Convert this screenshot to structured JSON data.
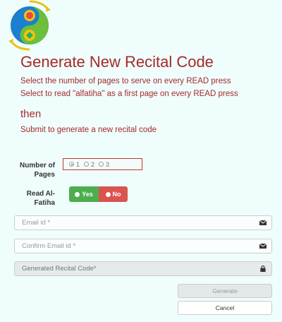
{
  "header": {
    "title": "Generate New Recital Code",
    "instruction_1": "Select the number of pages to serve on every READ press",
    "instruction_2": "Select to read \"alfatiha\" as a first page on every READ press",
    "then": "then",
    "instruction_3": "Submit to generate a new recital code"
  },
  "form": {
    "pages_label": "Number of Pages",
    "pages_options": [
      "1",
      "2",
      "3"
    ],
    "pages_selected": "1",
    "fatiha_label": "Read Al-Fatiha",
    "fatiha_yes": "Yes",
    "fatiha_no": "No",
    "email_placeholder": "Email id *",
    "confirm_email_placeholder": "Confirm Email id *",
    "code_placeholder": "Generated Recital Code*"
  },
  "actions": {
    "generate_label": "Generate",
    "cancel_label": "Cancel"
  },
  "colors": {
    "title": "#a52a2a",
    "yes": "#4cae4c",
    "no": "#d9534f",
    "background": "#effdfc"
  },
  "icons": {
    "logo": "yin-yang-logo",
    "email": "envelope-icon",
    "lock": "lock-icon"
  }
}
